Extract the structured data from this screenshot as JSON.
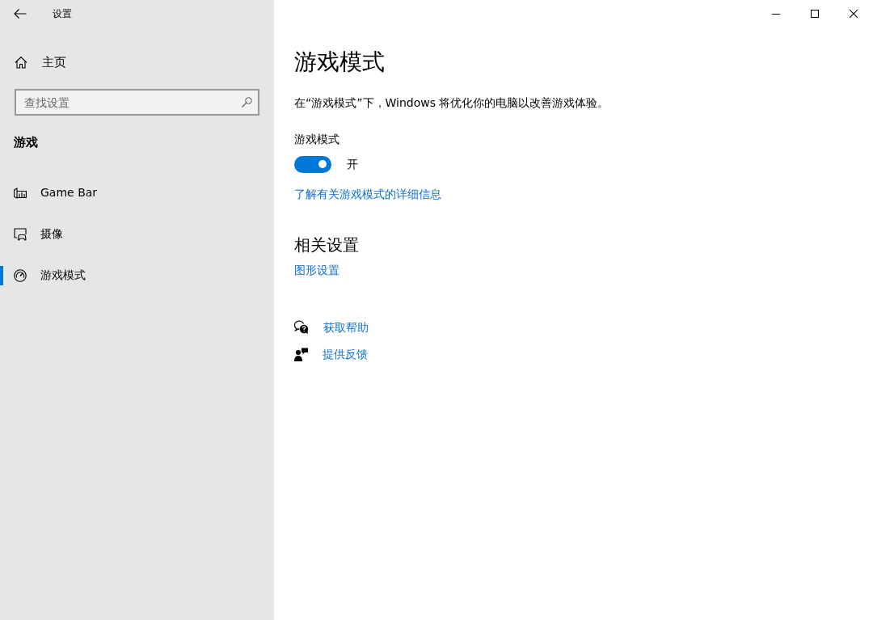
{
  "window": {
    "title": "设置"
  },
  "sidebar": {
    "home": "主页",
    "search": {
      "placeholder": "查找设置"
    },
    "section": "游戏",
    "items": [
      {
        "label": "Game Bar",
        "selected": false
      },
      {
        "label": "摄像",
        "selected": false
      },
      {
        "label": "游戏模式",
        "selected": true
      }
    ]
  },
  "page": {
    "title": "游戏模式",
    "description": "在“游戏模式”下，Windows 将优化你的电脑以改善游戏体验。",
    "toggle": {
      "label": "游戏模式",
      "on": true,
      "state_text": "开"
    },
    "learn_more": "了解有关游戏模式的详细信息"
  },
  "related": {
    "heading": "相关设置",
    "links": [
      "图形设置"
    ]
  },
  "help": [
    {
      "label": "获取帮助"
    },
    {
      "label": "提供反馈"
    }
  ]
}
